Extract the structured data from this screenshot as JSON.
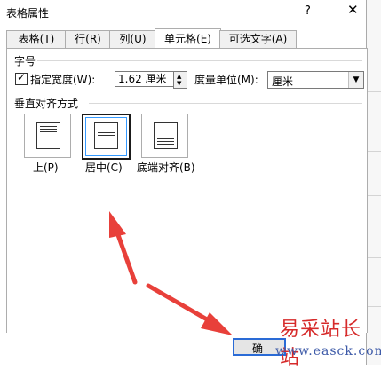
{
  "dialog": {
    "title": "表格属性",
    "help_label": "?",
    "close_label": "✕"
  },
  "tabs": [
    {
      "label": "表格(T)"
    },
    {
      "label": "行(R)"
    },
    {
      "label": "列(U)"
    },
    {
      "label": "单元格(E)",
      "active": true
    },
    {
      "label": "可选文字(A)"
    }
  ],
  "size_section": {
    "title": "字号",
    "checkbox_checked": true,
    "checkbox_label": "指定宽度(W):",
    "width_value": "1.62 厘米",
    "unit_label": "度量单位(M):",
    "unit_value": "厘米"
  },
  "valign_section": {
    "title": "垂直对齐方式",
    "options": [
      {
        "label": "上(P)"
      },
      {
        "label": "居中(C)",
        "selected": true
      },
      {
        "label": "底端对齐(B)"
      }
    ]
  },
  "footer": {
    "ok_label": "确"
  },
  "watermark": {
    "main": "易采站长站",
    "url": "www.easck.com"
  },
  "colors": {
    "arrow": "#e8403a",
    "focus_border": "#2a6bd6"
  }
}
